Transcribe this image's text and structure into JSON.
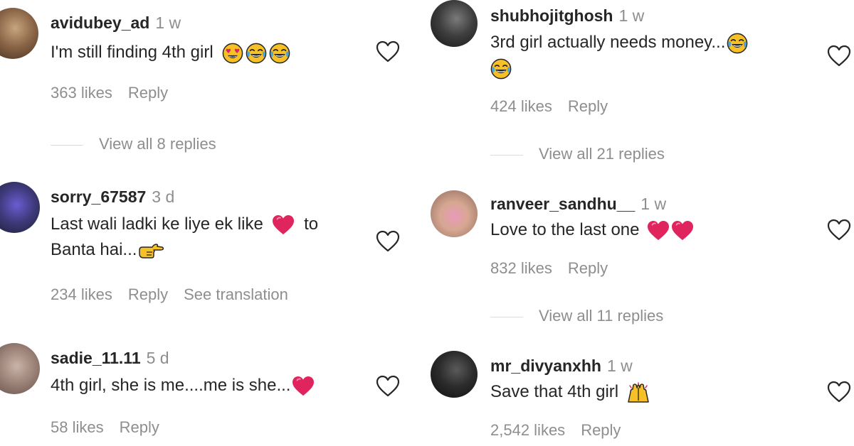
{
  "colors": {
    "text": "#262626",
    "muted": "#8e8e8e",
    "heart": "#e0245e",
    "emoji_face": "#f6c026"
  },
  "comments": [
    {
      "username": "avidubey_ad",
      "time": "1 w",
      "text": "I'm still finding 4th girl",
      "likes": "363 likes",
      "reply": "Reply",
      "view_replies": "View all 8 replies"
    },
    {
      "username": "sorry_67587",
      "time": "3 d",
      "text1": "Last wali ladki ke liye ek like",
      "text1b": "to",
      "text2": "Banta hai...",
      "likes": "234 likes",
      "reply": "Reply",
      "translate": "See translation"
    },
    {
      "username": "sadie_11.11",
      "time": "5 d",
      "text": "4th girl, she is me....me is she...",
      "likes": "58 likes",
      "reply": "Reply"
    },
    {
      "username": "shubhojitghosh",
      "time": "1 w",
      "text": "3rd girl actually needs money...",
      "likes": "424 likes",
      "reply": "Reply",
      "view_replies": "View all 21 replies"
    },
    {
      "username": "ranveer_sandhu__",
      "time": "1 w",
      "text": "Love to the last one",
      "likes": "832 likes",
      "reply": "Reply",
      "view_replies": "View all 11 replies"
    },
    {
      "username": "mr_divyanxhh",
      "time": "1 w",
      "text": "Save that 4th girl",
      "likes": "2,542 likes",
      "reply": "Reply"
    }
  ]
}
